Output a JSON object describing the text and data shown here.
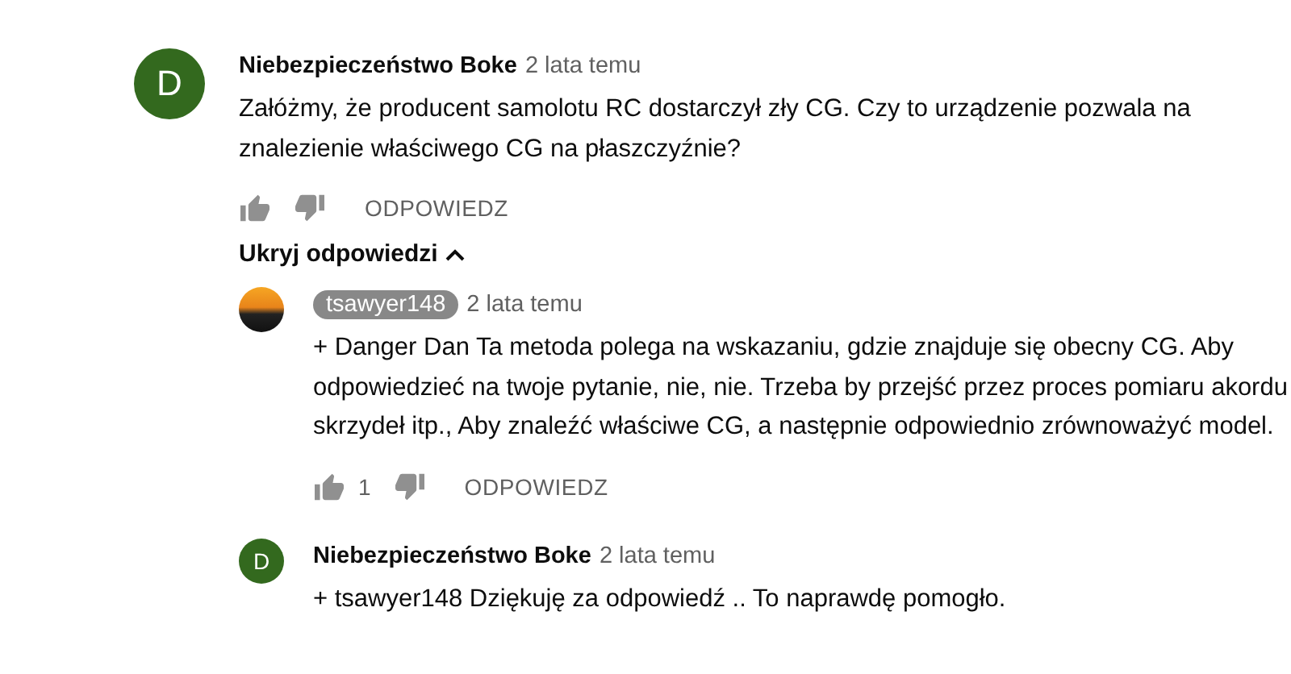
{
  "comment": {
    "author": {
      "name": "Niebezpieczeństwo Boke",
      "highlighted": false
    },
    "avatar": {
      "kind": "letter",
      "letter": "D",
      "color": "#33691e"
    },
    "time": "2 lata temu",
    "text": "Załóżmy, że producent samolotu RC dostarczył zły CG. Czy to urządzenie pozwala na znalezienie właściwego CG na płaszczyźnie?",
    "reply_button": "ODPOWIEDZ",
    "replies_toggle": {
      "label": "Ukryj odpowiedzi",
      "expanded": true
    },
    "replies": [
      {
        "author": {
          "name": "tsawyer148",
          "highlighted": true
        },
        "avatar": {
          "kind": "photo"
        },
        "time": "2 lata temu",
        "text": "+ Danger Dan Ta metoda polega na wskazaniu, gdzie znajduje się obecny CG. Aby odpowiedzieć na twoje pytanie, nie, nie. Trzeba by przejść przez proces pomiaru akordu skrzydeł itp., Aby znaleźć właściwe CG, a następnie odpowiednio zrównoważyć model.",
        "likes": "1",
        "reply_button": "ODPOWIEDZ"
      },
      {
        "author": {
          "name": "Niebezpieczeństwo Boke",
          "highlighted": false
        },
        "avatar": {
          "kind": "letter",
          "letter": "D",
          "color": "#33691e"
        },
        "time": "2 lata temu",
        "text": "+ tsawyer148 Dziękuję za odpowiedź .. To naprawdę pomogło."
      }
    ]
  }
}
